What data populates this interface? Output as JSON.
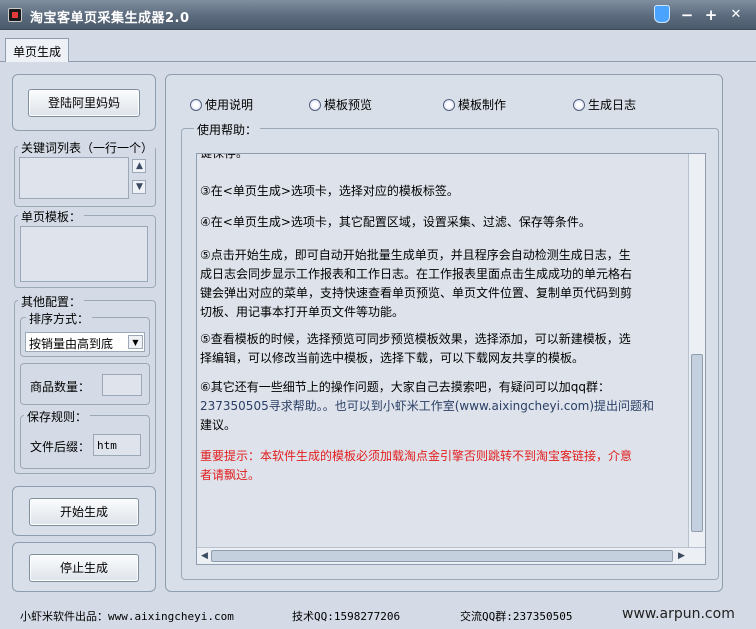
{
  "window": {
    "title": "淘宝客单页采集生成器2.0",
    "minimize": "−",
    "maximize": "+",
    "close": "✕"
  },
  "tabs": [
    {
      "label": "单页生成"
    }
  ],
  "left": {
    "login_button": "登陆阿里妈妈",
    "keyword_legend": "关键词列表（一行一个）",
    "template_legend": "单页模板：",
    "other_legend": "其他配置：",
    "sort_legend": "排序方式：",
    "sort_selected": "按销量由高到底",
    "quantity_label": "商品数量：",
    "quantity_value": "",
    "save_legend": "保存规则：",
    "suffix_label": "文件后缀：",
    "suffix_value": "htm",
    "start_button": "开始生成",
    "stop_button": "停止生成"
  },
  "right": {
    "radios": [
      {
        "label": "使用说明"
      },
      {
        "label": "模板预览"
      },
      {
        "label": "模板制作"
      },
      {
        "label": "生成日志"
      }
    ],
    "help_legend": "使用帮助：",
    "help_lines": [
      "键保存。",
      "③在<单页生成>选项卡，选择对应的模板标签。",
      "④在<单页生成>选项卡，其它配置区域，设置采集、过滤、保存等条件。",
      "⑤点击开始生成，即可自动开始批量生成单页，并且程序会自动检测生成日志，生",
      "成日志会同步显示工作报表和工作日志。在工作报表里面点击生成成功的单元格右",
      "键会弹出对应的菜单，支持快速查看单页预览、单页文件位置、复制单页代码到剪",
      "切板、用记事本打开单页文件等功能。",
      "⑤查看模板的时候，选择预览可同步预览模板效果，选择添加，可以新建模板，选",
      "择编辑，可以修改当前选中模板，选择下载，可以下载网友共享的模板。",
      "⑥其它还有一些细节上的操作问题，大家自己去摸索吧，有疑问可以加qq群：",
      "237350505寻求帮助。。也可以到小虾米工作室(www.aixingcheyi.com)提出问题和",
      "建议。",
      "重要提示：本软件生成的模板必须加载淘点金引擎否则跳转不到淘宝客链接，介意",
      "者请飘过。"
    ]
  },
  "status": {
    "vendor": "小虾米软件出品：www.aixingcheyi.com",
    "qq": "技术QQ:1598277206",
    "group": "交流QQ群:237350505",
    "watermark": "www.arpun.com"
  },
  "colors": {
    "title_bar": "#5b6b7d",
    "panel_bg": "#d4dbe6",
    "warning_text": "#e21d1d"
  }
}
